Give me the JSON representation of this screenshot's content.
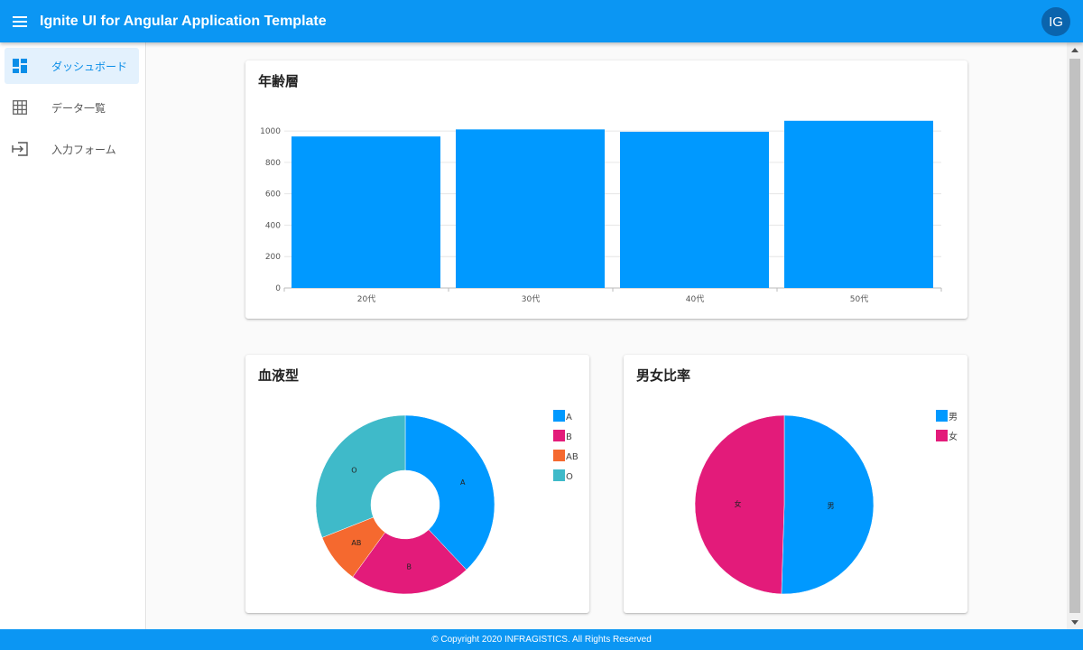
{
  "app": {
    "title": "Ignite UI for Angular Application Template",
    "avatar_initials": "IG"
  },
  "sidebar": {
    "items": [
      {
        "label": "ダッシュボード",
        "icon": "dashboard-icon",
        "active": true
      },
      {
        "label": "データ一覧",
        "icon": "grid-icon",
        "active": false
      },
      {
        "label": "入力フォーム",
        "icon": "input-icon",
        "active": false
      }
    ]
  },
  "cards": {
    "age": {
      "title": "年齢層"
    },
    "blood": {
      "title": "血液型"
    },
    "gender": {
      "title": "男女比率"
    }
  },
  "footer": {
    "text": "© Copyright 2020 INFRAGISTICS. All Rights Reserved"
  },
  "colors": {
    "primary": "#0b96f3",
    "blue": "#0099ff",
    "pink": "#e31b7a",
    "orange": "#f5692f",
    "teal": "#3fbac9"
  },
  "chart_data": [
    {
      "type": "bar",
      "title": "年齢層",
      "categories": [
        "20代",
        "30代",
        "40代",
        "50代"
      ],
      "values": [
        965,
        1010,
        995,
        1065
      ],
      "ylim": [
        0,
        1150
      ],
      "yticks": [
        0,
        200,
        400,
        600,
        800,
        1000
      ],
      "grid": true
    },
    {
      "type": "pie",
      "subtype": "donut",
      "title": "血液型",
      "categories": [
        "A",
        "B",
        "AB",
        "O"
      ],
      "values": [
        38,
        22,
        9,
        31
      ],
      "colors": [
        "#0099ff",
        "#e31b7a",
        "#f5692f",
        "#3fbac9"
      ],
      "legend": "top-right"
    },
    {
      "type": "pie",
      "title": "男女比率",
      "categories": [
        "男",
        "女"
      ],
      "values": [
        50.5,
        49.5
      ],
      "colors": [
        "#0099ff",
        "#e31b7a"
      ],
      "legend": "top-right"
    }
  ]
}
